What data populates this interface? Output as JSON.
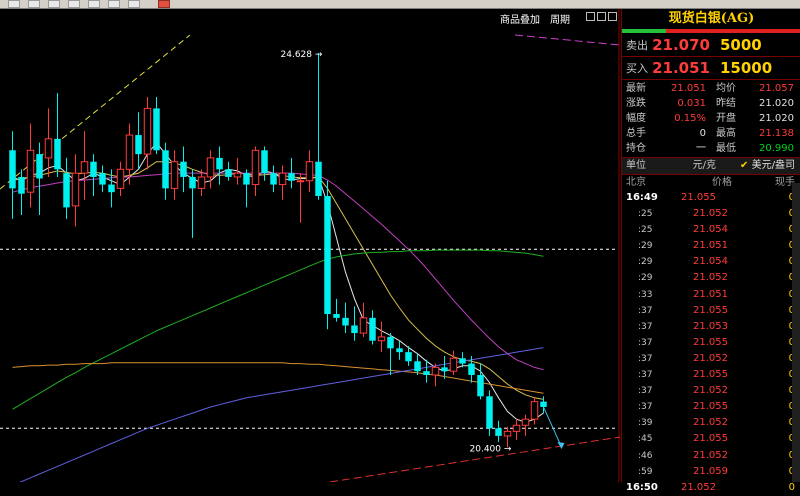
{
  "toolbar": {
    "buttons": [
      "btn-1",
      "btn-2",
      "btn-3",
      "btn-4",
      "btn-5",
      "btn-6",
      "btn-7"
    ]
  },
  "chart_header": {
    "overlay_label": "商品叠加",
    "period_label": "周期"
  },
  "panel": {
    "title": "现货白银(AG)",
    "sell": {
      "label": "卖出",
      "price": "21.070",
      "volume": "5000"
    },
    "buy": {
      "label": "买入",
      "price": "21.051",
      "volume": "15000"
    },
    "stats": [
      {
        "l1": "最新",
        "v1": "21.051",
        "c1": "red",
        "l2": "均价",
        "v2": "21.057",
        "c2": "red"
      },
      {
        "l1": "涨跌",
        "v1": "0.031",
        "c1": "red",
        "l2": "昨结",
        "v2": "21.020",
        "c2": "wht"
      },
      {
        "l1": "幅度",
        "v1": "0.15%",
        "c1": "red",
        "l2": "开盘",
        "v2": "21.020",
        "c2": "wht"
      },
      {
        "l1": "总手",
        "v1": "0",
        "c1": "wht",
        "l2": "最高",
        "v2": "21.138",
        "c2": "red"
      },
      {
        "l1": "持仓",
        "v1": "一",
        "c1": "wht",
        "l2": "最低",
        "v2": "20.990",
        "c2": "grn"
      }
    ],
    "unit_label": "单位",
    "unit_value": "元/克",
    "alt_unit_checkbox": "✔",
    "alt_unit": "美元/盎司",
    "ticks_header": {
      "time": "北京",
      "price": "价格",
      "vol": "现手"
    },
    "ticks": [
      {
        "t": "16:49",
        "p": "21.055",
        "v": "0"
      },
      {
        "t": ":25",
        "p": "21.052",
        "v": "0"
      },
      {
        "t": ":25",
        "p": "21.054",
        "v": "0"
      },
      {
        "t": ":29",
        "p": "21.051",
        "v": "0"
      },
      {
        "t": ":29",
        "p": "21.054",
        "v": "0"
      },
      {
        "t": ":29",
        "p": "21.052",
        "v": "0"
      },
      {
        "t": ":33",
        "p": "21.051",
        "v": "0"
      },
      {
        "t": ":37",
        "p": "21.055",
        "v": "0"
      },
      {
        "t": ":37",
        "p": "21.053",
        "v": "0"
      },
      {
        "t": ":37",
        "p": "21.055",
        "v": "0"
      },
      {
        "t": ":37",
        "p": "21.052",
        "v": "0"
      },
      {
        "t": ":37",
        "p": "21.055",
        "v": "0"
      },
      {
        "t": ":37",
        "p": "21.052",
        "v": "0"
      },
      {
        "t": ":37",
        "p": "21.055",
        "v": "0"
      },
      {
        "t": ":39",
        "p": "21.052",
        "v": "0"
      },
      {
        "t": ":45",
        "p": "21.055",
        "v": "0"
      },
      {
        "t": ":46",
        "p": "21.052",
        "v": "0"
      },
      {
        "t": ":59",
        "p": "21.059",
        "v": "0"
      },
      {
        "t": "16:50",
        "p": "21.052",
        "v": "0"
      }
    ]
  },
  "chart_data": {
    "type": "candlestick",
    "annotations": {
      "high_label": "24.628",
      "low_label": "20.400"
    },
    "ylim": [
      19.1,
      25.1
    ],
    "candles": [
      {
        "o": 23.35,
        "h": 23.6,
        "l": 22.45,
        "c": 22.85
      },
      {
        "o": 23.0,
        "h": 23.1,
        "l": 22.5,
        "c": 22.78
      },
      {
        "o": 22.8,
        "h": 23.7,
        "l": 22.6,
        "c": 23.35
      },
      {
        "o": 23.3,
        "h": 23.45,
        "l": 22.5,
        "c": 22.98
      },
      {
        "o": 23.25,
        "h": 23.9,
        "l": 23.0,
        "c": 23.5
      },
      {
        "o": 23.5,
        "h": 24.1,
        "l": 23.0,
        "c": 23.1
      },
      {
        "o": 23.05,
        "h": 23.25,
        "l": 22.45,
        "c": 22.6
      },
      {
        "o": 22.62,
        "h": 23.3,
        "l": 22.35,
        "c": 23.05
      },
      {
        "o": 23.05,
        "h": 23.6,
        "l": 22.7,
        "c": 23.2
      },
      {
        "o": 23.2,
        "h": 23.3,
        "l": 22.75,
        "c": 23.0
      },
      {
        "o": 23.05,
        "h": 23.15,
        "l": 22.8,
        "c": 22.9
      },
      {
        "o": 22.9,
        "h": 23.1,
        "l": 22.6,
        "c": 22.8
      },
      {
        "o": 22.85,
        "h": 23.2,
        "l": 22.75,
        "c": 23.1
      },
      {
        "o": 23.1,
        "h": 23.7,
        "l": 22.9,
        "c": 23.55
      },
      {
        "o": 23.55,
        "h": 23.85,
        "l": 23.1,
        "c": 23.3
      },
      {
        "o": 23.3,
        "h": 24.05,
        "l": 23.1,
        "c": 23.9
      },
      {
        "o": 23.9,
        "h": 24.05,
        "l": 23.3,
        "c": 23.35
      },
      {
        "o": 23.35,
        "h": 23.45,
        "l": 22.7,
        "c": 22.85
      },
      {
        "o": 22.85,
        "h": 23.35,
        "l": 22.7,
        "c": 23.2
      },
      {
        "o": 23.2,
        "h": 23.4,
        "l": 22.8,
        "c": 23.0
      },
      {
        "o": 23.0,
        "h": 23.1,
        "l": 22.2,
        "c": 22.85
      },
      {
        "o": 22.85,
        "h": 23.1,
        "l": 22.75,
        "c": 23.0
      },
      {
        "o": 23.0,
        "h": 23.35,
        "l": 22.85,
        "c": 23.25
      },
      {
        "o": 23.25,
        "h": 23.4,
        "l": 22.9,
        "c": 23.1
      },
      {
        "o": 23.1,
        "h": 23.2,
        "l": 22.95,
        "c": 23.0
      },
      {
        "o": 23.0,
        "h": 23.25,
        "l": 22.9,
        "c": 23.05
      },
      {
        "o": 23.05,
        "h": 23.1,
        "l": 22.6,
        "c": 22.9
      },
      {
        "o": 22.9,
        "h": 23.4,
        "l": 22.75,
        "c": 23.35
      },
      {
        "o": 23.35,
        "h": 23.4,
        "l": 22.95,
        "c": 23.05
      },
      {
        "o": 23.05,
        "h": 23.15,
        "l": 22.8,
        "c": 22.9
      },
      {
        "o": 22.9,
        "h": 23.15,
        "l": 22.7,
        "c": 23.05
      },
      {
        "o": 23.05,
        "h": 23.25,
        "l": 22.85,
        "c": 22.95
      },
      {
        "o": 22.95,
        "h": 23.05,
        "l": 22.4,
        "c": 22.95
      },
      {
        "o": 22.95,
        "h": 23.35,
        "l": 22.8,
        "c": 23.2
      },
      {
        "o": 23.2,
        "h": 24.628,
        "l": 22.7,
        "c": 22.75
      },
      {
        "o": 22.75,
        "h": 22.95,
        "l": 21.0,
        "c": 21.2
      },
      {
        "o": 21.2,
        "h": 21.4,
        "l": 21.1,
        "c": 21.15
      },
      {
        "o": 21.15,
        "h": 21.35,
        "l": 20.95,
        "c": 21.05
      },
      {
        "o": 21.05,
        "h": 21.3,
        "l": 20.85,
        "c": 20.95
      },
      {
        "o": 20.95,
        "h": 21.35,
        "l": 20.9,
        "c": 21.15
      },
      {
        "o": 21.15,
        "h": 21.25,
        "l": 20.8,
        "c": 20.85
      },
      {
        "o": 20.85,
        "h": 21.1,
        "l": 20.7,
        "c": 20.9
      },
      {
        "o": 20.9,
        "h": 20.95,
        "l": 20.4,
        "c": 20.75
      },
      {
        "o": 20.75,
        "h": 20.85,
        "l": 20.6,
        "c": 20.7
      },
      {
        "o": 20.7,
        "h": 20.78,
        "l": 20.52,
        "c": 20.58
      },
      {
        "o": 20.58,
        "h": 20.68,
        "l": 20.4,
        "c": 20.45
      },
      {
        "o": 20.45,
        "h": 20.6,
        "l": 20.3,
        "c": 20.4
      },
      {
        "o": 20.4,
        "h": 20.55,
        "l": 20.25,
        "c": 20.5
      },
      {
        "o": 20.5,
        "h": 20.65,
        "l": 20.35,
        "c": 20.45
      },
      {
        "o": 20.45,
        "h": 20.72,
        "l": 20.4,
        "c": 20.62
      },
      {
        "o": 20.62,
        "h": 20.7,
        "l": 20.5,
        "c": 20.55
      },
      {
        "o": 20.55,
        "h": 20.65,
        "l": 20.3,
        "c": 20.4
      },
      {
        "o": 20.4,
        "h": 20.55,
        "l": 20.08,
        "c": 20.12
      },
      {
        "o": 20.12,
        "h": 20.2,
        "l": 19.6,
        "c": 19.7
      },
      {
        "o": 19.7,
        "h": 19.8,
        "l": 19.52,
        "c": 19.6
      },
      {
        "o": 19.6,
        "h": 19.72,
        "l": 19.45,
        "c": 19.66
      },
      {
        "o": 19.66,
        "h": 19.82,
        "l": 19.55,
        "c": 19.74
      },
      {
        "o": 19.74,
        "h": 19.88,
        "l": 19.6,
        "c": 19.82
      },
      {
        "o": 19.82,
        "h": 20.1,
        "l": 19.75,
        "c": 20.05
      },
      {
        "o": 20.05,
        "h": 20.12,
        "l": 19.9,
        "c": 19.98
      }
    ],
    "ma_series": [
      {
        "color": "#e6e6e6",
        "values": [
          23.0,
          22.95,
          23.02,
          23.05,
          23.12,
          23.15,
          23.05,
          22.95,
          22.98,
          23.05,
          23.0,
          22.95,
          22.9,
          23.0,
          23.1,
          23.3,
          23.45,
          23.3,
          23.15,
          23.05,
          22.98,
          22.92,
          22.95,
          23.05,
          23.1,
          23.08,
          23.02,
          23.0,
          23.08,
          23.05,
          22.98,
          22.96,
          22.98,
          22.98,
          23.0,
          22.65,
          22.2,
          21.75,
          21.4,
          21.12,
          21.05,
          20.98,
          20.92,
          20.85,
          20.76,
          20.68,
          20.58,
          20.5,
          20.45,
          20.48,
          20.52,
          20.52,
          20.45,
          20.3,
          20.1,
          19.92,
          19.82,
          19.78,
          19.82,
          19.9
        ]
      },
      {
        "color": "#d8c050",
        "values": [
          22.95,
          22.98,
          23.0,
          23.02,
          23.05,
          23.08,
          23.06,
          23.04,
          23.05,
          23.06,
          23.05,
          23.02,
          23.0,
          23.02,
          23.05,
          23.12,
          23.2,
          23.2,
          23.18,
          23.15,
          23.1,
          23.06,
          23.03,
          23.02,
          23.03,
          23.05,
          23.04,
          23.02,
          23.03,
          23.04,
          23.02,
          23.0,
          22.99,
          22.99,
          23.0,
          22.85,
          22.65,
          22.45,
          22.25,
          22.05,
          21.85,
          21.65,
          21.45,
          21.28,
          21.12,
          21.0,
          20.88,
          20.78,
          20.7,
          20.64,
          20.6,
          20.58,
          20.55,
          20.48,
          20.38,
          20.28,
          20.2,
          20.14,
          20.1,
          20.08
        ]
      },
      {
        "color": "#c040c0",
        "values": [
          22.8,
          22.83,
          22.86,
          22.88,
          22.9,
          22.92,
          22.94,
          22.95,
          22.96,
          22.97,
          22.98,
          22.99,
          23.0,
          23.0,
          23.01,
          23.02,
          23.03,
          23.04,
          23.05,
          23.05,
          23.05,
          23.05,
          23.05,
          23.05,
          23.05,
          23.05,
          23.05,
          23.05,
          23.05,
          23.05,
          23.05,
          23.05,
          23.04,
          23.03,
          23.02,
          22.96,
          22.88,
          22.78,
          22.68,
          22.58,
          22.48,
          22.38,
          22.27,
          22.16,
          22.05,
          21.93,
          21.8,
          21.66,
          21.52,
          21.38,
          21.25,
          21.12,
          21.0,
          20.88,
          20.77,
          20.68,
          20.6,
          20.55,
          20.5,
          20.47
        ]
      },
      {
        "color": "#20b020",
        "values": [
          19.95,
          20.02,
          20.09,
          20.16,
          20.23,
          20.3,
          20.37,
          20.43,
          20.5,
          20.56,
          20.62,
          20.68,
          20.74,
          20.8,
          20.86,
          20.92,
          20.98,
          21.03,
          21.08,
          21.13,
          21.18,
          21.23,
          21.28,
          21.33,
          21.38,
          21.43,
          21.48,
          21.53,
          21.58,
          21.63,
          21.68,
          21.73,
          21.78,
          21.83,
          21.88,
          21.92,
          21.95,
          21.97,
          21.99,
          22.0,
          22.01,
          22.01,
          22.02,
          22.02,
          22.03,
          22.03,
          22.03,
          22.04,
          22.04,
          22.04,
          22.04,
          22.04,
          22.04,
          22.03,
          22.03,
          22.02,
          22.01,
          22.0,
          21.98,
          21.96
        ]
      },
      {
        "color": "#d89030",
        "values": [
          20.5,
          20.51,
          20.52,
          20.52,
          20.53,
          20.53,
          20.54,
          20.54,
          20.55,
          20.55,
          20.55,
          20.56,
          20.56,
          20.56,
          20.56,
          20.56,
          20.56,
          20.56,
          20.56,
          20.56,
          20.56,
          20.56,
          20.56,
          20.56,
          20.56,
          20.56,
          20.56,
          20.56,
          20.56,
          20.56,
          20.56,
          20.55,
          20.55,
          20.54,
          20.54,
          20.53,
          20.52,
          20.51,
          20.5,
          20.49,
          20.48,
          20.47,
          20.46,
          20.45,
          20.44,
          20.43,
          20.41,
          20.4,
          20.38,
          20.36,
          20.34,
          20.32,
          20.3,
          20.28,
          20.26,
          20.24,
          20.22,
          20.2,
          20.18,
          20.16
        ]
      },
      {
        "color": "#6060e0",
        "values": [
          18.95,
          19.0,
          19.05,
          19.1,
          19.15,
          19.2,
          19.25,
          19.3,
          19.35,
          19.4,
          19.45,
          19.5,
          19.55,
          19.6,
          19.65,
          19.7,
          19.74,
          19.78,
          19.82,
          19.86,
          19.9,
          19.94,
          19.98,
          20.01,
          20.04,
          20.07,
          20.1,
          20.12,
          20.14,
          20.16,
          20.18,
          20.2,
          20.22,
          20.24,
          20.26,
          20.28,
          20.3,
          20.32,
          20.34,
          20.36,
          20.38,
          20.4,
          20.42,
          20.44,
          20.46,
          20.48,
          20.5,
          20.52,
          20.54,
          20.56,
          20.58,
          20.6,
          20.62,
          20.64,
          20.66,
          20.68,
          20.7,
          20.72,
          20.74,
          20.76
        ]
      }
    ],
    "price_levels": [
      {
        "value": 22.05,
        "style": "dashed"
      },
      {
        "value": 19.7,
        "style": "dashed"
      }
    ]
  }
}
